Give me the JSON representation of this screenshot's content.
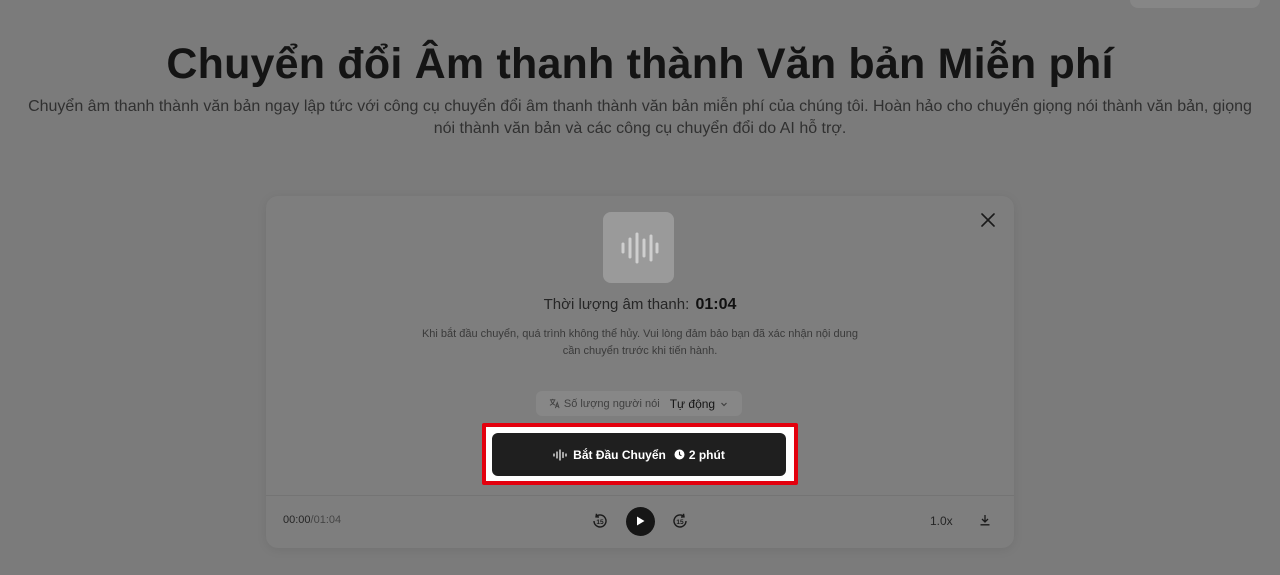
{
  "hero": {
    "title": "Chuyển đổi Âm thanh thành Văn bản Miễn phí",
    "subtitle": "Chuyển âm thanh thành văn bản ngay lập tức với công cụ chuyển đổi âm thanh thành văn bản miễn phí của chúng tôi. Hoàn hảo cho chuyển giọng nói thành văn bản, giọng nói thành văn bản và các công cụ chuyển đổi do AI hỗ trợ."
  },
  "dialog": {
    "duration_label": "Thời lượng âm thanh:",
    "duration_value": "01:04",
    "notice": "Khi bắt đầu chuyển, quá trình không thể hủy. Vui lòng đảm bảo bạn đã xác nhận nội dung cần chuyển trước khi tiến hành.",
    "speaker_label": "Số lượng người nói",
    "speaker_value": "Tự động",
    "start_label": "Bắt Đầu Chuyển",
    "start_time": "2 phút"
  },
  "player": {
    "current": "00:00",
    "total": "/01:04",
    "skip_back": "15",
    "skip_forward": "15",
    "speed": "1.0x"
  },
  "colors": {
    "highlight": "#e3000e",
    "button_bg": "#1f1f1f"
  },
  "icons": [
    "close-icon",
    "audio-wave-icon",
    "translate-icon",
    "chevron-down-icon",
    "waveform-icon",
    "clock-icon",
    "rewind-15-icon",
    "play-icon",
    "forward-15-icon",
    "download-icon"
  ]
}
